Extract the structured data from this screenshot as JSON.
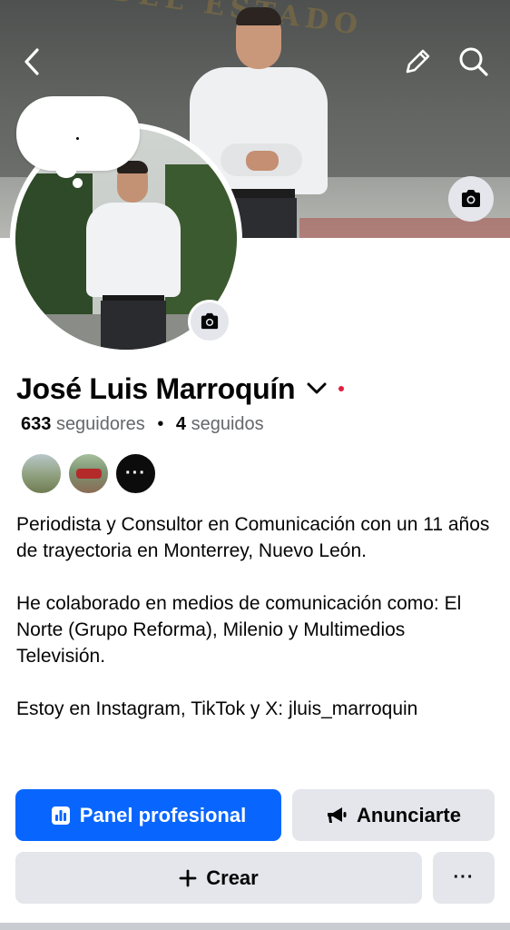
{
  "cover": {
    "icons": [
      "back-icon",
      "pencil-icon",
      "search-icon",
      "camera-icon"
    ]
  },
  "profile": {
    "name": "José Luis Marroquín",
    "followers_count": "633",
    "followers_label": "seguidores",
    "separator": "•",
    "following_count": "4",
    "following_label": "seguidos",
    "friends_more": "···"
  },
  "bio": {
    "paragraphs": [
      "Periodista y Consultor en Comunicación con un 11 años de trayectoria en Monterrey, Nuevo León.",
      "He colaborado en medios de comunicación como: El Norte (Grupo Reforma), Milenio y Multimedios Televisión.",
      "Estoy en Instagram, TikTok y X: jluis_marroquin"
    ]
  },
  "actions": {
    "panel_label": "Panel profesional",
    "ads_label": "Anunciarte",
    "create_label": "Crear",
    "more_label": "···"
  },
  "colors": {
    "primary": "#0866ff",
    "secondary_bg": "#e4e6eb",
    "text": "#050505",
    "muted": "#65676b",
    "status_dot": "#e41e3f"
  }
}
